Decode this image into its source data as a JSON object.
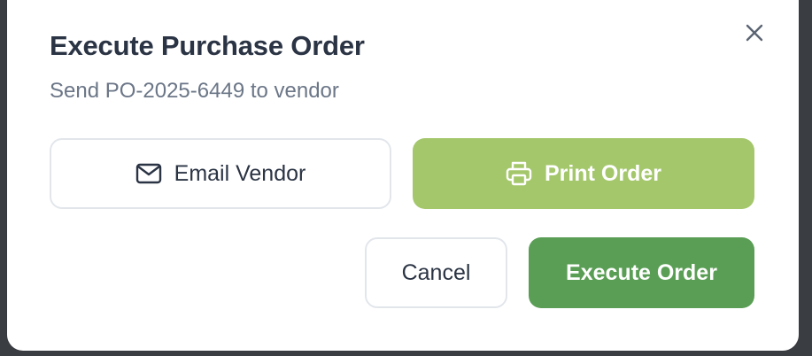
{
  "dialog": {
    "title": "Execute Purchase Order",
    "subtitle": "Send PO-2025-6449 to vendor"
  },
  "actions": {
    "email_label": "Email Vendor",
    "email_icon": "mail-icon",
    "print_label": "Print Order",
    "print_icon": "printer-icon",
    "cancel_label": "Cancel",
    "execute_label": "Execute Order",
    "close_icon": "close-icon"
  },
  "colors": {
    "print_button": "#a5c76c",
    "execute_button": "#5a9e55",
    "title_text": "#2b3444",
    "subtitle_text": "#6b7687"
  }
}
